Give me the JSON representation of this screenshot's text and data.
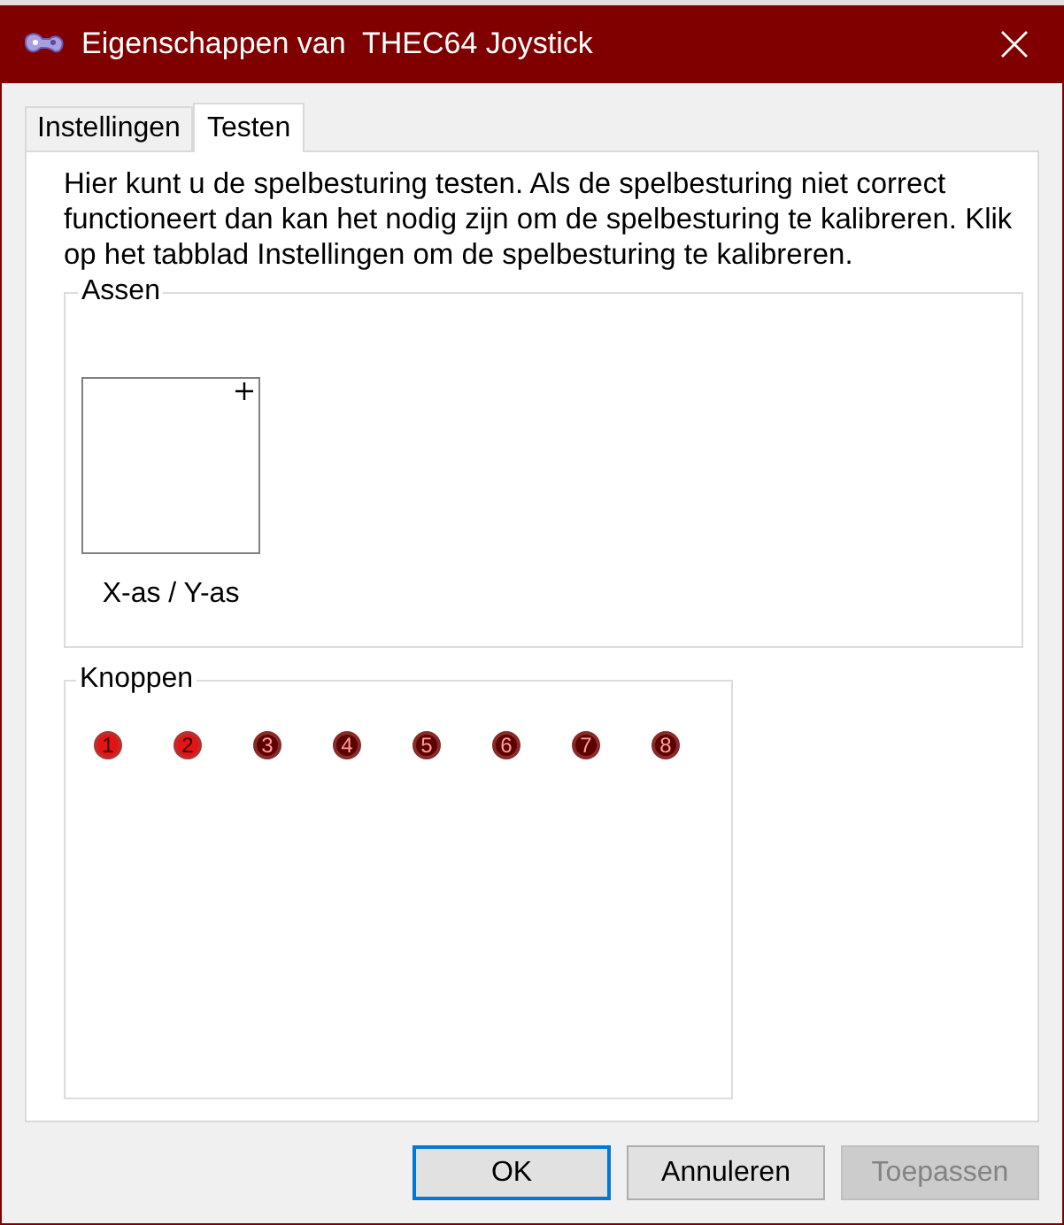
{
  "window": {
    "title": "Eigenschappen van  THEC64 Joystick"
  },
  "tabs": [
    {
      "label": "Instellingen",
      "selected": false
    },
    {
      "label": "Testen",
      "selected": true
    }
  ],
  "description": "Hier kunt u de spelbesturing testen. Als de spelbesturing niet correct functioneert dan kan het nodig zijn om de spelbesturing te kalibreren. Klik op het tabblad Instellingen om de spelbesturing te kalibreren.",
  "axes": {
    "legend": "Assen",
    "label": "X-as / Y-as"
  },
  "buttons_group": {
    "legend": "Knoppen",
    "buttons": [
      {
        "label": "1",
        "pressed": true
      },
      {
        "label": "2",
        "pressed": true
      },
      {
        "label": "3",
        "pressed": false
      },
      {
        "label": "4",
        "pressed": false
      },
      {
        "label": "5",
        "pressed": false
      },
      {
        "label": "6",
        "pressed": false
      },
      {
        "label": "7",
        "pressed": false
      },
      {
        "label": "8",
        "pressed": false
      }
    ]
  },
  "dialog_buttons": [
    {
      "label": "OK",
      "default": true,
      "disabled": false
    },
    {
      "label": "Annuleren",
      "default": false,
      "disabled": false
    },
    {
      "label": "Toepassen",
      "default": false,
      "disabled": true
    }
  ]
}
